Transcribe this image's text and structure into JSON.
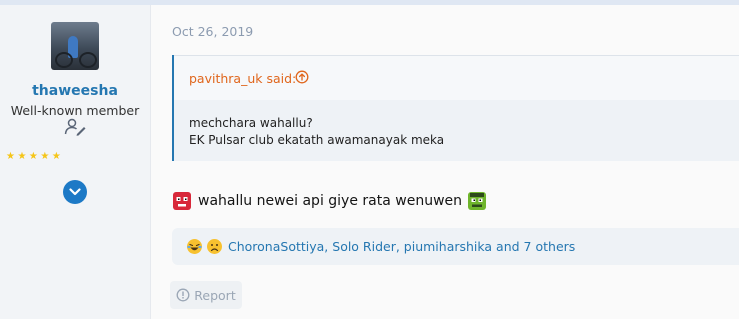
{
  "user": {
    "name": "thaweesha",
    "title": "Well-known member",
    "stars": "★★★★★",
    "icons": {
      "member": "user-edit-icon",
      "expand": "chevron-down-icon"
    }
  },
  "post": {
    "date": "Oct 26, 2019",
    "quote": {
      "author_label": "pavithra_uk said:",
      "lines": [
        "mechchara wahallu?",
        "EK Pulsar club ekatath awamanayak meka"
      ]
    },
    "message": "wahallu newei api giye rata wenuwen",
    "reactions": {
      "icons": [
        "laughing-reaction-icon",
        "sad-reaction-icon"
      ],
      "text": "ChoronaSottiya, Solo Rider, piumiharshika and 7 others"
    },
    "report_label": "Report"
  },
  "colors": {
    "accent": "#2577b1",
    "quote_author": "#e0661c",
    "date": "#8c9bb0"
  }
}
